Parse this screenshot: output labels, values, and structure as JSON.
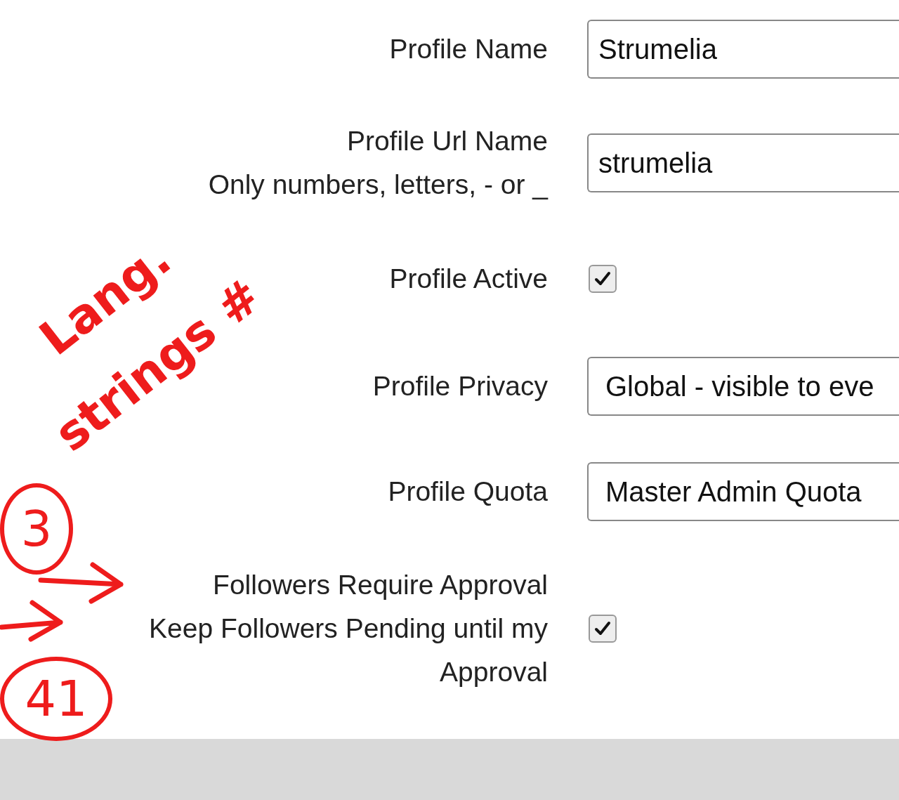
{
  "form": {
    "rows": [
      {
        "kind": "text",
        "label": "Profile Name",
        "value": "Strumelia"
      },
      {
        "kind": "text",
        "label": "Profile Url Name",
        "hint": "Only numbers, letters, - or _",
        "value": "strumelia"
      },
      {
        "kind": "checkbox",
        "label": "Profile Active",
        "checked": true
      },
      {
        "kind": "select",
        "label": "Profile Privacy",
        "value": "Global - visible to eve"
      },
      {
        "kind": "select",
        "label": "Profile Quota",
        "value": "Master Admin Quota"
      },
      {
        "kind": "checkbox",
        "label": "Followers Require Approval",
        "hint": "Keep Followers Pending until my Approval",
        "checked": true
      }
    ]
  },
  "annotations": [
    {
      "kind": "note",
      "text": "Lang."
    },
    {
      "kind": "note",
      "text": "strings #"
    },
    {
      "kind": "circled",
      "text": "3"
    },
    {
      "kind": "circled",
      "text": "41"
    },
    {
      "kind": "arrow"
    },
    {
      "kind": "arrow"
    }
  ]
}
